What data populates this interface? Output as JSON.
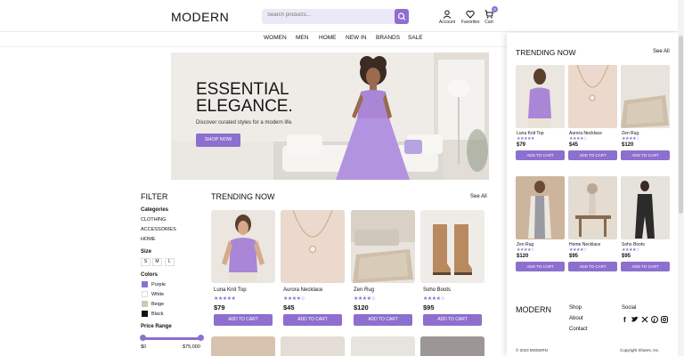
{
  "header": {
    "logo": "MODERN",
    "search_placeholder": "Search products...",
    "account_label": "Account",
    "favorites_label": "Favorites",
    "cart_label": "Cart",
    "cart_count": "0"
  },
  "nav": [
    "WOMEN",
    "MEN",
    "HOME",
    "NEW IN",
    "BRANDS",
    "SALE"
  ],
  "hero": {
    "title_line1": "ESSENTIAL",
    "title_line2": "ELEGANCE.",
    "subtitle": "Discover curated styles for a modern life.",
    "button": "SHOP NOW"
  },
  "filter": {
    "title": "FILTER",
    "categories_label": "Categories",
    "categories": [
      "CLOTHING",
      "ACCESSORIES",
      "HOME"
    ],
    "size_label": "Size",
    "sizes": [
      "S",
      "M",
      "L"
    ],
    "colors_label": "Colors",
    "colors": [
      {
        "name": "Purple",
        "hex": "#8c6fce"
      },
      {
        "name": "White",
        "hex": "#ffffff"
      },
      {
        "name": "Beige",
        "hex": "#d8c6b0"
      },
      {
        "name": "Black",
        "hex": "#111111"
      }
    ],
    "price_label": "Price Range",
    "price_min": "$0",
    "price_max": "$75,000"
  },
  "trending": {
    "title": "TRENDING NOW",
    "see_all": "See All",
    "products": [
      {
        "name": "Luna Knit Top",
        "stars": "★★★★★",
        "price": "$79",
        "button": "ADD TO CART"
      },
      {
        "name": "Aurora Necklace",
        "stars": "★★★★☆",
        "price": "$45",
        "button": "ADD TO CART"
      },
      {
        "name": "Zen Rug",
        "stars": "★★★★☆",
        "price": "$120",
        "button": "ADD TO CART"
      },
      {
        "name": "Soho Boots",
        "stars": "★★★★☆",
        "price": "$95",
        "button": "ADD TO CART"
      }
    ]
  },
  "panel": {
    "title": "TRENDING NOW",
    "see_all": "See All",
    "products": [
      {
        "name": "Luna Knit Top",
        "stars": "★★★★★",
        "price": "$79",
        "button": "ADD TO CART"
      },
      {
        "name": "Aurora Necklace",
        "stars": "★★★★☆",
        "price": "$45",
        "button": "ADD TO CART"
      },
      {
        "name": "Zen Rug",
        "stars": "★★★★☆",
        "price": "$120",
        "button": "ADD TO CART"
      },
      {
        "name": "Zen Rug",
        "stars": "★★★★☆",
        "price": "$120",
        "button": "ADD TO CART"
      },
      {
        "name": "Home Necklace",
        "stars": "★★★★☆",
        "price": "$95",
        "button": "ADD TO CART"
      },
      {
        "name": "Soho Boots",
        "stars": "★★★★☆",
        "price": "$95",
        "button": "ADD TO CART"
      }
    ],
    "footer": {
      "logo": "MODERN",
      "links": [
        "Shop",
        "About",
        "Contact"
      ],
      "social_label": "Social",
      "copyright_left": "© 2023 MODERN",
      "copyright_right": "Copyright Shares, Inc."
    }
  },
  "accent_color": "#8c6fce"
}
